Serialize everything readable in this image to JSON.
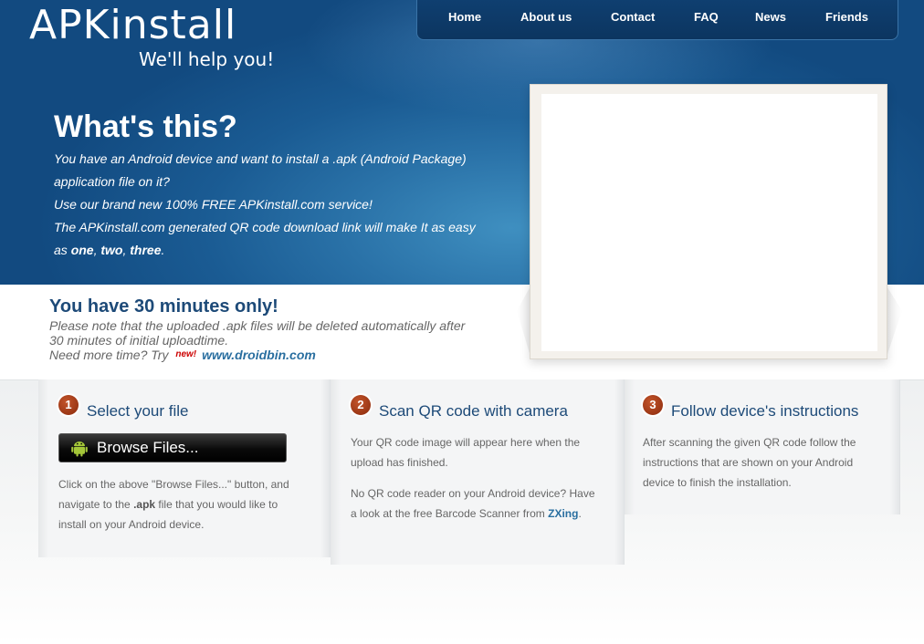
{
  "header": {
    "logo": "APKinstall",
    "tagline": "We'll help you!"
  },
  "nav": {
    "items": [
      {
        "label": "Home"
      },
      {
        "label": "About us"
      },
      {
        "label": "Contact"
      },
      {
        "label": "FAQ"
      },
      {
        "label": "News"
      },
      {
        "label": "Friends"
      }
    ]
  },
  "hero": {
    "title": "What's this?",
    "line1": "You have an Android device and want to install a .apk (Android Package) application file on it?",
    "line2": "Use our brand new 100% FREE APKinstall.com service!",
    "line3_prefix": "The APKinstall.com generated QR code download link will make It as easy as ",
    "one": "one",
    "comma1": ", ",
    "two": "two",
    "comma2": ", ",
    "three": "three",
    "period": "."
  },
  "notice": {
    "title": "You have 30 minutes only!",
    "text": "Please note that the uploaded .apk files will be deleted automatically after 30 minutes of initial uploadtime.",
    "more_prefix": "Need more time? Try ",
    "new_badge": "new!",
    "link": "www.droidbin.com"
  },
  "steps": [
    {
      "number": "1",
      "title": "Select your file",
      "button_label": "Browse Files...",
      "text_prefix": "Click on the above \"Browse Files...\" button, and navigate to the ",
      "text_bold": ".apk",
      "text_suffix": " file that you would like to install on your Android device."
    },
    {
      "number": "2",
      "title": "Scan QR code with camera",
      "text1": "Your QR code image will appear here when the upload has finished.",
      "text2_prefix": "No QR code reader on your Android device? Have a look at the free Barcode Scanner from ",
      "link": "ZXing",
      "text2_suffix": "."
    },
    {
      "number": "3",
      "title": "Follow device's instructions",
      "text": "After scanning the given QR code follow the instructions that are shown on your Android device to finish the installation."
    }
  ],
  "colors": {
    "hero_blue": "#1a5b93",
    "title_blue": "#1d4a78",
    "link_blue": "#2a6fa0",
    "step_badge": "#8a2a0c",
    "android_green": "#a4c639"
  }
}
